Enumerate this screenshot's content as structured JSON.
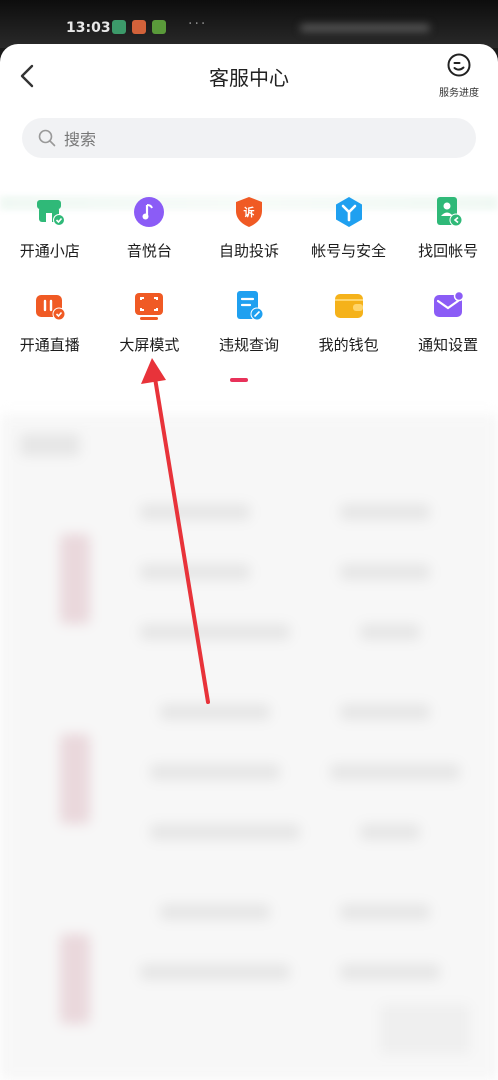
{
  "status_bar": {
    "time": "13:03"
  },
  "header": {
    "title": "客服中心",
    "progress_label": "服务进度"
  },
  "search": {
    "placeholder": "搜索"
  },
  "services": [
    {
      "label": "开通小店",
      "icon": "store-icon",
      "color": "#2fb978"
    },
    {
      "label": "音悦台",
      "icon": "music-disc-icon",
      "color": "#8b5cf6"
    },
    {
      "label": "自助投诉",
      "icon": "complaint-shield-icon",
      "color": "#f05a24"
    },
    {
      "label": "帐号与安全",
      "icon": "account-security-icon",
      "color": "#1fa0f0"
    },
    {
      "label": "找回帐号",
      "icon": "recover-account-icon",
      "color": "#2fb978"
    },
    {
      "label": "开通直播",
      "icon": "live-stream-icon",
      "color": "#f05a24"
    },
    {
      "label": "大屏模式",
      "icon": "big-screen-icon",
      "color": "#f05a24"
    },
    {
      "label": "违规查询",
      "icon": "violation-query-icon",
      "color": "#1fa0f0"
    },
    {
      "label": "我的钱包",
      "icon": "wallet-icon",
      "color": "#f5b21a"
    },
    {
      "label": "通知设置",
      "icon": "notification-settings-icon",
      "color": "#8b5cf6"
    }
  ],
  "accent_color": "#e8325a",
  "annotation_color": "#e8333a"
}
